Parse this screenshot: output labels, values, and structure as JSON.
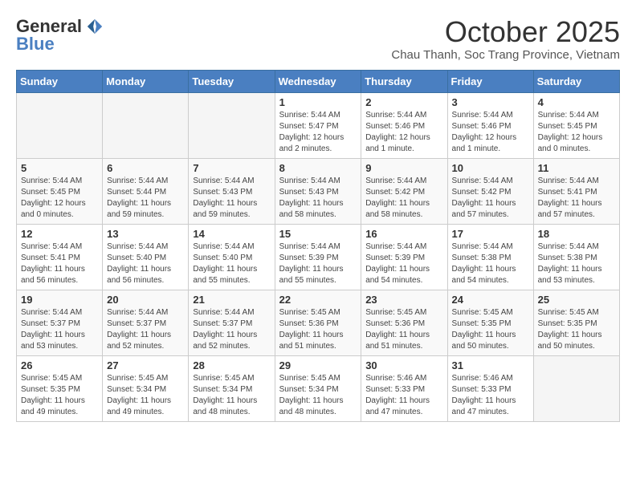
{
  "header": {
    "logo_general": "General",
    "logo_blue": "Blue",
    "month_title": "October 2025",
    "subtitle": "Chau Thanh, Soc Trang Province, Vietnam"
  },
  "weekdays": [
    "Sunday",
    "Monday",
    "Tuesday",
    "Wednesday",
    "Thursday",
    "Friday",
    "Saturday"
  ],
  "weeks": [
    [
      {
        "day": "",
        "info": ""
      },
      {
        "day": "",
        "info": ""
      },
      {
        "day": "",
        "info": ""
      },
      {
        "day": "1",
        "info": "Sunrise: 5:44 AM\nSunset: 5:47 PM\nDaylight: 12 hours\nand 2 minutes."
      },
      {
        "day": "2",
        "info": "Sunrise: 5:44 AM\nSunset: 5:46 PM\nDaylight: 12 hours\nand 1 minute."
      },
      {
        "day": "3",
        "info": "Sunrise: 5:44 AM\nSunset: 5:46 PM\nDaylight: 12 hours\nand 1 minute."
      },
      {
        "day": "4",
        "info": "Sunrise: 5:44 AM\nSunset: 5:45 PM\nDaylight: 12 hours\nand 0 minutes."
      }
    ],
    [
      {
        "day": "5",
        "info": "Sunrise: 5:44 AM\nSunset: 5:45 PM\nDaylight: 12 hours\nand 0 minutes."
      },
      {
        "day": "6",
        "info": "Sunrise: 5:44 AM\nSunset: 5:44 PM\nDaylight: 11 hours\nand 59 minutes."
      },
      {
        "day": "7",
        "info": "Sunrise: 5:44 AM\nSunset: 5:43 PM\nDaylight: 11 hours\nand 59 minutes."
      },
      {
        "day": "8",
        "info": "Sunrise: 5:44 AM\nSunset: 5:43 PM\nDaylight: 11 hours\nand 58 minutes."
      },
      {
        "day": "9",
        "info": "Sunrise: 5:44 AM\nSunset: 5:42 PM\nDaylight: 11 hours\nand 58 minutes."
      },
      {
        "day": "10",
        "info": "Sunrise: 5:44 AM\nSunset: 5:42 PM\nDaylight: 11 hours\nand 57 minutes."
      },
      {
        "day": "11",
        "info": "Sunrise: 5:44 AM\nSunset: 5:41 PM\nDaylight: 11 hours\nand 57 minutes."
      }
    ],
    [
      {
        "day": "12",
        "info": "Sunrise: 5:44 AM\nSunset: 5:41 PM\nDaylight: 11 hours\nand 56 minutes."
      },
      {
        "day": "13",
        "info": "Sunrise: 5:44 AM\nSunset: 5:40 PM\nDaylight: 11 hours\nand 56 minutes."
      },
      {
        "day": "14",
        "info": "Sunrise: 5:44 AM\nSunset: 5:40 PM\nDaylight: 11 hours\nand 55 minutes."
      },
      {
        "day": "15",
        "info": "Sunrise: 5:44 AM\nSunset: 5:39 PM\nDaylight: 11 hours\nand 55 minutes."
      },
      {
        "day": "16",
        "info": "Sunrise: 5:44 AM\nSunset: 5:39 PM\nDaylight: 11 hours\nand 54 minutes."
      },
      {
        "day": "17",
        "info": "Sunrise: 5:44 AM\nSunset: 5:38 PM\nDaylight: 11 hours\nand 54 minutes."
      },
      {
        "day": "18",
        "info": "Sunrise: 5:44 AM\nSunset: 5:38 PM\nDaylight: 11 hours\nand 53 minutes."
      }
    ],
    [
      {
        "day": "19",
        "info": "Sunrise: 5:44 AM\nSunset: 5:37 PM\nDaylight: 11 hours\nand 53 minutes."
      },
      {
        "day": "20",
        "info": "Sunrise: 5:44 AM\nSunset: 5:37 PM\nDaylight: 11 hours\nand 52 minutes."
      },
      {
        "day": "21",
        "info": "Sunrise: 5:44 AM\nSunset: 5:37 PM\nDaylight: 11 hours\nand 52 minutes."
      },
      {
        "day": "22",
        "info": "Sunrise: 5:45 AM\nSunset: 5:36 PM\nDaylight: 11 hours\nand 51 minutes."
      },
      {
        "day": "23",
        "info": "Sunrise: 5:45 AM\nSunset: 5:36 PM\nDaylight: 11 hours\nand 51 minutes."
      },
      {
        "day": "24",
        "info": "Sunrise: 5:45 AM\nSunset: 5:35 PM\nDaylight: 11 hours\nand 50 minutes."
      },
      {
        "day": "25",
        "info": "Sunrise: 5:45 AM\nSunset: 5:35 PM\nDaylight: 11 hours\nand 50 minutes."
      }
    ],
    [
      {
        "day": "26",
        "info": "Sunrise: 5:45 AM\nSunset: 5:35 PM\nDaylight: 11 hours\nand 49 minutes."
      },
      {
        "day": "27",
        "info": "Sunrise: 5:45 AM\nSunset: 5:34 PM\nDaylight: 11 hours\nand 49 minutes."
      },
      {
        "day": "28",
        "info": "Sunrise: 5:45 AM\nSunset: 5:34 PM\nDaylight: 11 hours\nand 48 minutes."
      },
      {
        "day": "29",
        "info": "Sunrise: 5:45 AM\nSunset: 5:34 PM\nDaylight: 11 hours\nand 48 minutes."
      },
      {
        "day": "30",
        "info": "Sunrise: 5:46 AM\nSunset: 5:33 PM\nDaylight: 11 hours\nand 47 minutes."
      },
      {
        "day": "31",
        "info": "Sunrise: 5:46 AM\nSunset: 5:33 PM\nDaylight: 11 hours\nand 47 minutes."
      },
      {
        "day": "",
        "info": ""
      }
    ]
  ]
}
